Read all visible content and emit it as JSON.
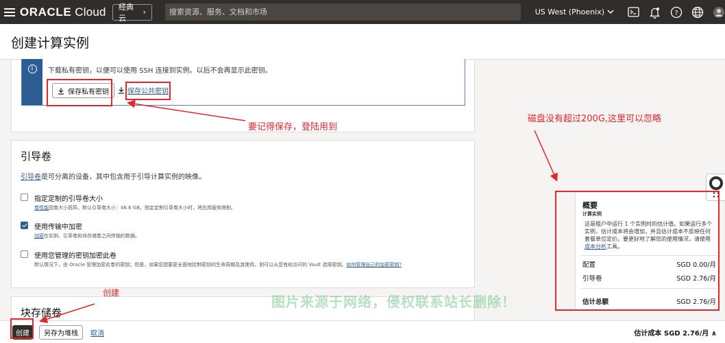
{
  "topbar": {
    "logo_brand": "ORACLE",
    "logo_product": "Cloud",
    "classic_label": "经典云",
    "search_placeholder": "搜索资源、服务、文档和市场",
    "region": "US West (Phoenix)"
  },
  "page": {
    "title": "创建计算实例"
  },
  "ssh_keys": {
    "info_text": "下载私有密钥，以便可以使用 SSH 连接到实例。以后不会再显示此密钥。",
    "save_private_label": "保存私有密钥",
    "save_public_label": "保存公共密钥"
  },
  "boot_volume": {
    "title": "引导卷",
    "desc_link": "引导卷",
    "desc_rest": "是可分离的设备，其中包含用于引导计算实例的映像。",
    "options": [
      {
        "label": "指定定制的引导卷大小",
        "checked": false,
        "help_link": "卷性能",
        "help_rest": "因卷大小而异。默认引导卷大小：46.6 GB。指定定制引导卷大小时，将应用服务限制。"
      },
      {
        "label": "使用传输中加密",
        "checked": true,
        "help_link": "加密",
        "help_rest": "在实例、引导卷和块存储卷之间传输的数据。"
      },
      {
        "label": "使用您管理的密钥加密此卷",
        "checked": false,
        "help_rest": "默认情况下，由 Oracle 管理加密此卷的密钥；但是，如果您想要更全面地控制密钥的生命周期及其使用，则可以从您有权访问的 Vault 选择密钥。",
        "help_link": "如何管理自己的加密密钥?"
      }
    ]
  },
  "block_storage": {
    "title": "块存储卷"
  },
  "footer": {
    "create_label": "创建",
    "save_stack_label": "另存为堆栈",
    "cancel_label": "取消",
    "estimated_cost": "估计成本 SGD 2.76/月"
  },
  "summary": {
    "title": "概要",
    "subtitle": "计算实例",
    "desc_pre": "这是租户中运行 1 个实例时的估计值。如果运行多个实例，估计成本将会增加，并且估计成本不反映任何套餐单位定价。要更好地了解您的使用情况，请使用",
    "desc_link": "成本分析",
    "desc_post": "工具。",
    "rows": [
      {
        "label": "配置",
        "value": "SGD 0.00/月"
      },
      {
        "label": "引导卷",
        "value": "SGD 2.76/月"
      }
    ],
    "total_label": "估计总额",
    "total_value": "SGD 2.76/月"
  },
  "annotations": {
    "save_note": "要记得保存，登陆用到",
    "disk_note": "磁盘没有超过200G,这里可以忽略",
    "create_note": "创建",
    "watermark": "图片来源于网络，侵权联系站长删除！"
  },
  "colors": {
    "topbar_bg": "#312d2a",
    "accent_blue": "#2c5d93",
    "annotation_red": "#e3262b"
  }
}
